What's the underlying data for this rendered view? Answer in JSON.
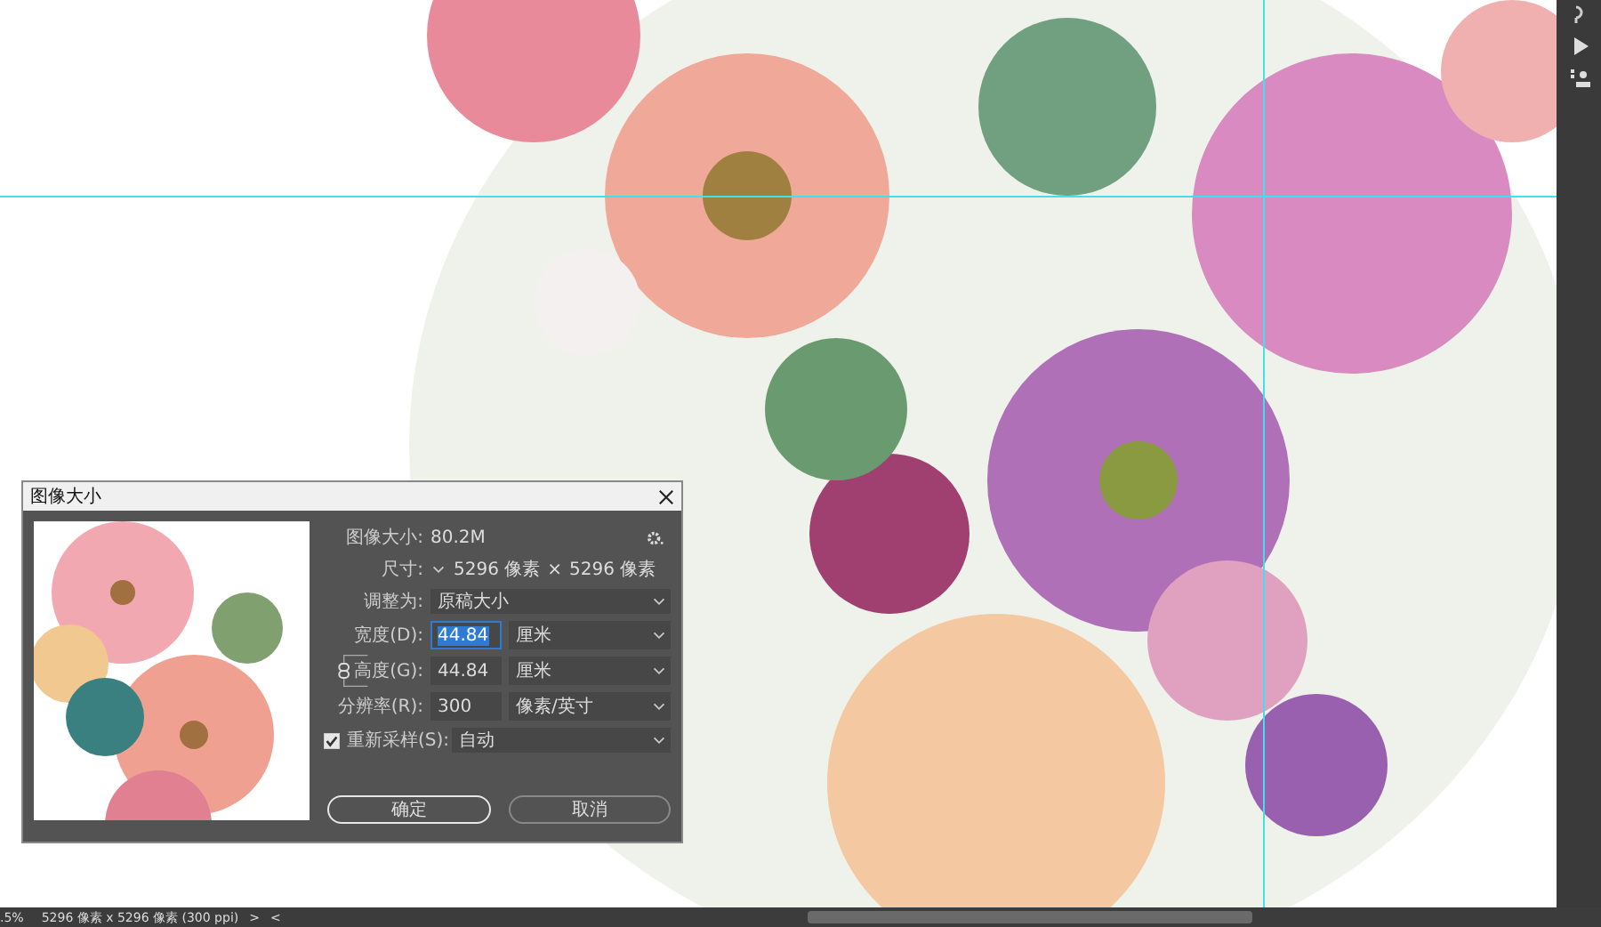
{
  "dialog": {
    "title": "图像大小",
    "image_size": {
      "label": "图像大小:",
      "value": "80.2M"
    },
    "dimensions": {
      "label": "尺寸:",
      "width": "5296 像素",
      "times": "×",
      "height": "5296 像素"
    },
    "fit_to": {
      "label": "调整为:",
      "value": "原稿大小"
    },
    "constrain": {
      "on": true
    },
    "fields": [
      {
        "label": "宽度(D):",
        "value": "44.84",
        "text_selected": true,
        "unit": "厘米"
      },
      {
        "label": "高度(G):",
        "value": "44.84",
        "text_selected": false,
        "unit": "厘米"
      },
      {
        "label": "分辨率(R):",
        "value": "300",
        "text_selected": false,
        "unit": "像素/英寸"
      }
    ],
    "resample": {
      "label": "重新采样(S):",
      "checked": true,
      "value": "自动"
    },
    "buttons": [
      {
        "label": "确定",
        "default": true
      },
      {
        "label": "取消",
        "default": false
      }
    ]
  },
  "status_bar": {
    "zoom": ".5%",
    "doc_info": "5296 像素 x 5296 像素 (300 ppi)",
    "more": ">",
    "prev": "<"
  }
}
